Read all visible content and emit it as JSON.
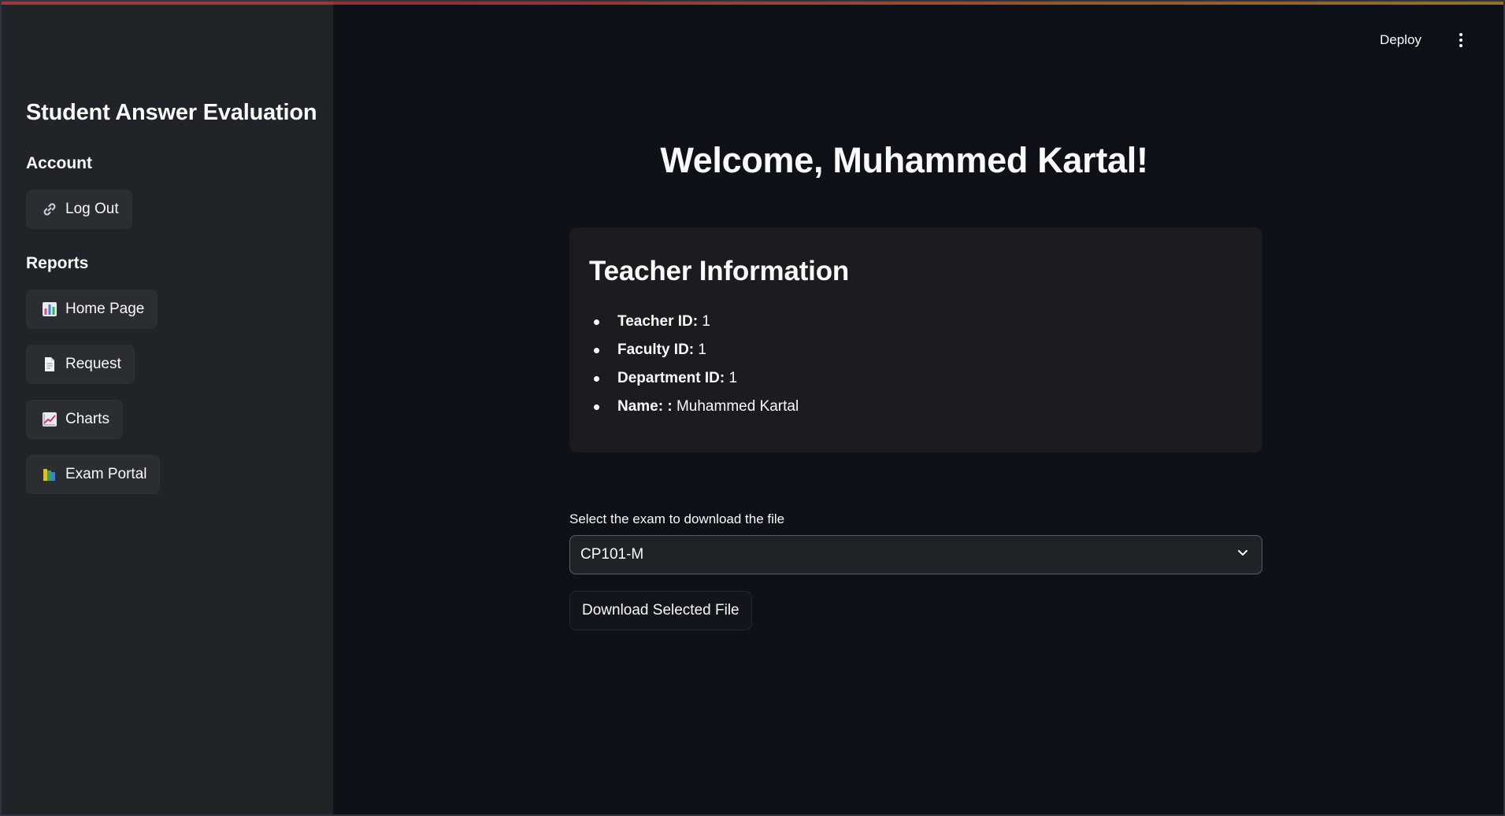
{
  "header": {
    "deploy_label": "Deploy"
  },
  "sidebar": {
    "title": "Student Answer Evaluation",
    "account": {
      "label": "Account",
      "logout_label": "Log Out"
    },
    "reports": {
      "label": "Reports",
      "items": [
        {
          "label": "Home Page",
          "icon": "bar-chart-icon"
        },
        {
          "label": "Request",
          "icon": "page-icon"
        },
        {
          "label": "Charts",
          "icon": "chart-increasing-icon"
        },
        {
          "label": "Exam Portal",
          "icon": "books-icon"
        }
      ]
    }
  },
  "main": {
    "welcome": "Welcome, Muhammed Kartal!",
    "teacher_card": {
      "title": "Teacher Information",
      "fields": [
        {
          "label": "Teacher ID:",
          "value": "1"
        },
        {
          "label": "Faculty ID:",
          "value": "1"
        },
        {
          "label": "Department ID:",
          "value": "1"
        },
        {
          "label": "Name: :",
          "value": "Muhammed Kartal"
        }
      ]
    },
    "exam_select": {
      "label": "Select the exam to download the file",
      "selected": "CP101-M"
    },
    "download_label": "Download Selected File"
  },
  "colors": {
    "background": "#0e1117",
    "sidebar": "#212427",
    "text": "#fafafa"
  }
}
